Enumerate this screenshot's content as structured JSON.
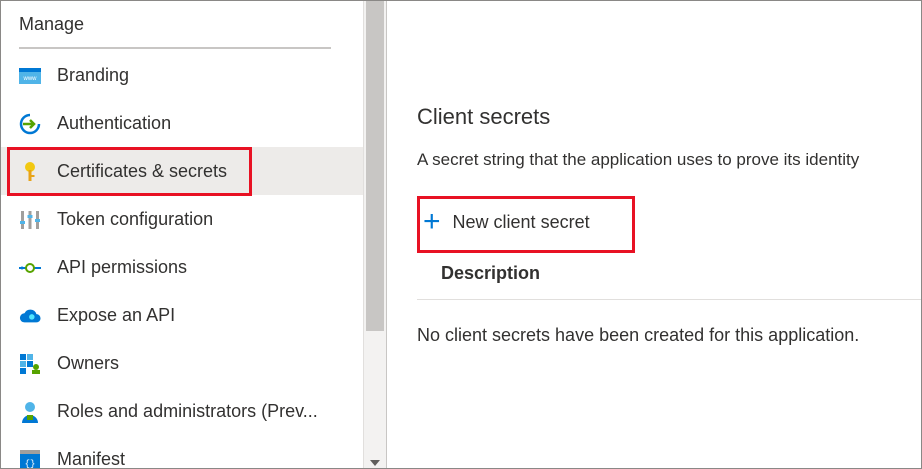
{
  "sidebar": {
    "heading": "Manage",
    "items": [
      {
        "label": "Branding",
        "icon": "branding-icon"
      },
      {
        "label": "Authentication",
        "icon": "authentication-icon"
      },
      {
        "label": "Certificates & secrets",
        "icon": "key-icon",
        "active": true
      },
      {
        "label": "Token configuration",
        "icon": "token-config-icon"
      },
      {
        "label": "API permissions",
        "icon": "api-permissions-icon"
      },
      {
        "label": "Expose an API",
        "icon": "cloud-api-icon"
      },
      {
        "label": "Owners",
        "icon": "owners-icon"
      },
      {
        "label": "Roles and administrators (Prev...",
        "icon": "roles-icon"
      },
      {
        "label": "Manifest",
        "icon": "manifest-icon"
      }
    ]
  },
  "main": {
    "title": "Client secrets",
    "description": "A secret string that the application uses to prove its identity",
    "new_button_label": "New client secret",
    "table": {
      "columns": [
        "Description"
      ],
      "empty_message": "No client secrets have been created for this application."
    }
  },
  "colors": {
    "accent": "#0078d4",
    "highlight": "#e81123",
    "active_bg": "#edebe9"
  }
}
